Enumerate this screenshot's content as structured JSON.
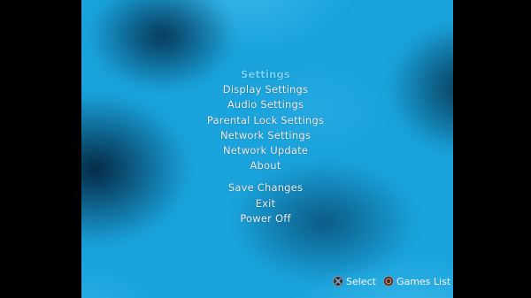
{
  "menu": {
    "title": "Settings",
    "items": [
      {
        "label": "Display Settings"
      },
      {
        "label": "Audio Settings"
      },
      {
        "label": "Parental Lock Settings"
      },
      {
        "label": "Network Settings"
      },
      {
        "label": "Network Update"
      },
      {
        "label": "About"
      }
    ],
    "actions": [
      {
        "label": "Save Changes"
      },
      {
        "label": "Exit"
      },
      {
        "label": "Power Off"
      }
    ]
  },
  "footer": {
    "select": {
      "icon": "cross-button-icon",
      "label": "Select"
    },
    "back": {
      "icon": "circle-button-icon",
      "label": "Games List"
    }
  },
  "colors": {
    "background": "#1aa3dc",
    "title": "#6fd8ff",
    "text": "#f2f6fa",
    "cross_symbol": "#8fb0d8",
    "circle_symbol": "#e07a4a"
  }
}
